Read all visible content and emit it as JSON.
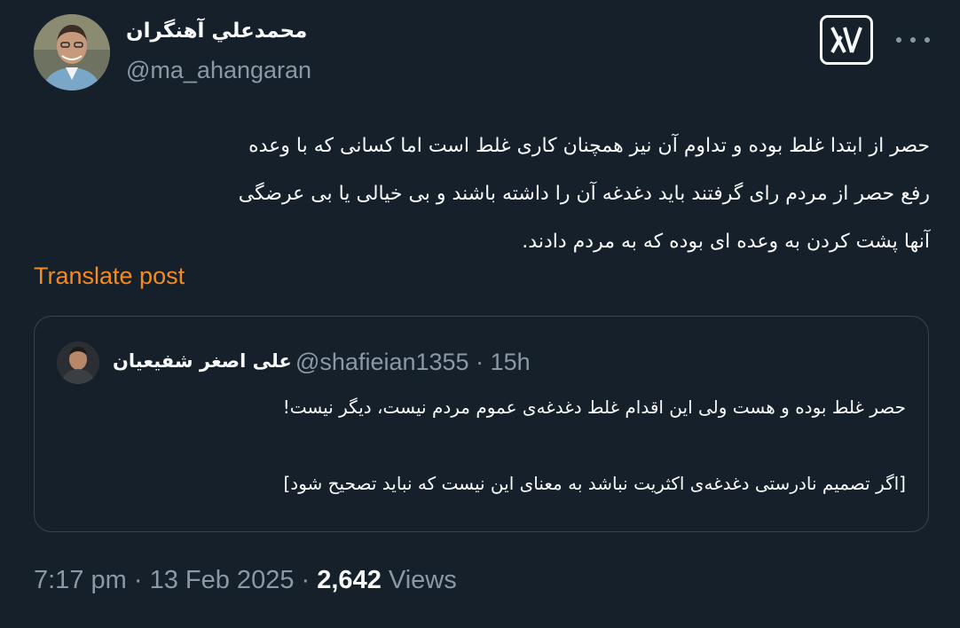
{
  "author": {
    "name": "محمدعلي آهنگران",
    "handle": "@ma_ahangaran"
  },
  "icons": {
    "logo": "x-logo-icon",
    "more": "more-options-icon"
  },
  "post": {
    "lines": [
      "حصر از ابتدا غلط بوده و تداوم آن نیز همچنان کاری غلط است  اما کسانی که با وعده",
      "رفع حصر از مردم رای گرفتند باید دغدغه آن را داشته باشند و بی خیالی یا بی عرضگی",
      "آنها پشت کردن به وعده ای بوده که به مردم دادند."
    ]
  },
  "translate_label": "Translate post",
  "quote": {
    "name": "علی اصغر شفیعیان",
    "handle": "@shafieian1355",
    "separator": "·",
    "time": "15h",
    "line1": "حصر غلط بوده و  هست ولی این اقدام غلط دغدغه‌ی عموم مردم نیست، دیگر نیست!",
    "line2": "[اگر تصمیم نادرستی دغدغه‌ی اکثریت نباشد به معنای این نیست که نباید تصحیح شود]"
  },
  "footer": {
    "time": "7:17 pm",
    "separator": "·",
    "date": "13 Feb 2025",
    "views_count": "2,642",
    "views_label": "Views"
  },
  "colors": {
    "background": "#15202b",
    "text": "#f7f9f9",
    "muted": "#8b98a5",
    "accent": "#f58b1f",
    "border": "#38444d"
  }
}
